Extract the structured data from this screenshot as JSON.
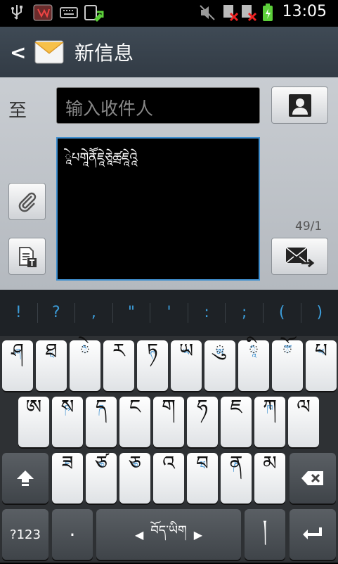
{
  "status_bar": {
    "time": "13:05"
  },
  "title_bar": {
    "title": "新信息"
  },
  "compose": {
    "to_label": "至",
    "recipient_placeholder": "输入收件人",
    "message_text": "ཱེཔགཱེནཽཇཱེཅཱེཚྲཇཱེའཱེ",
    "counter": "49/1"
  },
  "suggestions": [
    "!",
    "?",
    ",",
    "\"",
    "'",
    ":",
    ";",
    "(",
    ")"
  ],
  "keyboard": {
    "row1": [
      {
        "main": "ཤ",
        "hint": "ཞ"
      },
      {
        "main": "ཐ",
        "hint": "ཱ"
      },
      {
        "main": "ེ",
        "hint": "ཻ"
      },
      {
        "main": "ར",
        "hint": ""
      },
      {
        "main": "ཏ",
        "hint": "ཊ"
      },
      {
        "main": "ཡ",
        "hint": "ཡ"
      },
      {
        "main": "ུ",
        "hint": "ཨ"
      },
      {
        "main": "ི",
        "hint": "ཱི"
      },
      {
        "main": "ོ",
        "hint": "ཽ"
      },
      {
        "main": "པ",
        "hint": "ཕ"
      }
    ],
    "row2": [
      {
        "main": "ཨ",
        "hint": ""
      },
      {
        "main": "ས",
        "hint": "ཥ"
      },
      {
        "main": "ད",
        "hint": "ཌ"
      },
      {
        "main": "ང",
        "hint": ""
      },
      {
        "main": "ག",
        "hint": ""
      },
      {
        "main": "ཧ",
        "hint": ""
      },
      {
        "main": "ཇ",
        "hint": ""
      },
      {
        "main": "ཀ",
        "hint": "ཁ"
      },
      {
        "main": "ལ",
        "hint": ""
      }
    ],
    "row3": [
      {
        "main": "ཟ",
        "hint": "ཛ"
      },
      {
        "main": "ཙ",
        "hint": "ཚ"
      },
      {
        "main": "ཅ",
        "hint": "ཆ"
      },
      {
        "main": "འ",
        "hint": ""
      },
      {
        "main": "བ",
        "hint": "ཝ"
      },
      {
        "main": "ན",
        "hint": "ཎ"
      },
      {
        "main": "མ",
        "hint": ""
      }
    ],
    "sym_label": "?123",
    "period_label": "·",
    "space_label": "བོད་ཡིག",
    "shad_label": "།"
  }
}
